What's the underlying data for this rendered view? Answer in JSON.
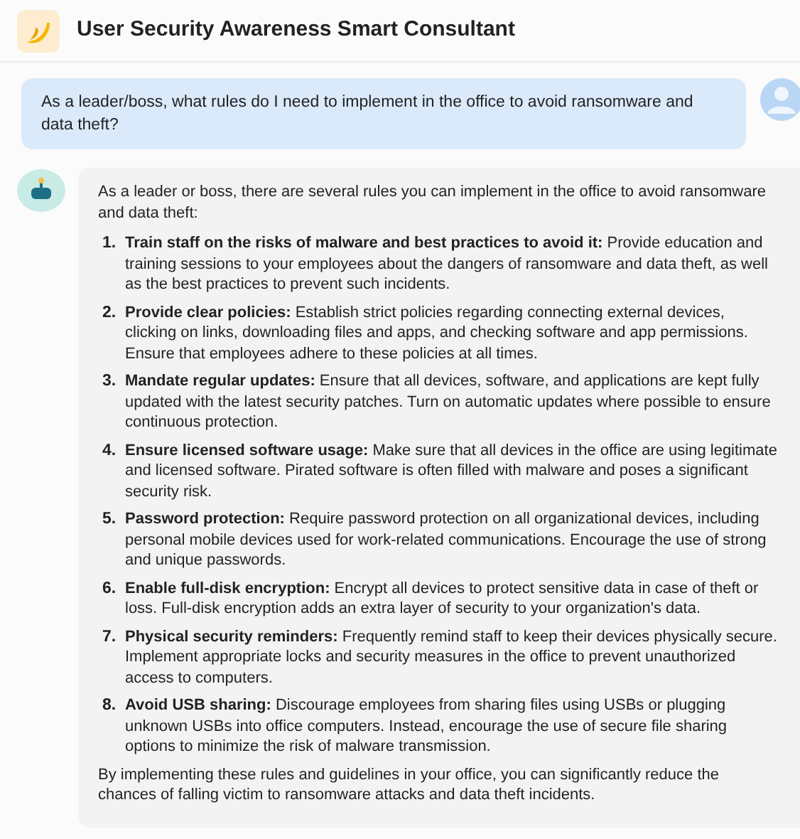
{
  "header": {
    "title": "User Security Awareness Smart Consultant"
  },
  "user_message": {
    "text": "As a leader/boss, what rules do I need to implement in the office to avoid ransomware and data theft?"
  },
  "answer": {
    "intro": "As a leader or boss, there are several rules you can implement in the office to avoid ransomware and data theft:",
    "items": [
      {
        "number": "1.",
        "text": "**Train staff on the risks of malware and best practices to avoid it:** Provide education and training sessions to your employees about the dangers of ransomware and data theft, as well as the best practices to prevent such incidents."
      },
      {
        "number": "2.",
        "text": "**Provide clear policies:** Establish strict policies regarding connecting external devices, clicking on links, downloading files and apps, and checking software and app permissions. Ensure that employees adhere to these policies at all times."
      },
      {
        "number": "3.",
        "text": "**Mandate regular updates:** Ensure that all devices, software, and applications are kept fully updated with the latest security patches. Turn on automatic updates where possible to ensure continuous protection."
      },
      {
        "number": "4.",
        "text": "**Ensure licensed software usage:** Make sure that all devices in the office are using legitimate and licensed software. Pirated software is often filled with malware and poses a significant security risk."
      },
      {
        "number": "5.",
        "text": "**Password protection:** Require password protection on all organizational devices, including personal mobile devices used for work-related communications. Encourage the use of strong and unique passwords."
      },
      {
        "number": "6.",
        "text": "**Enable full-disk encryption:** Encrypt all devices to protect sensitive data in case of theft or loss. Full-disk encryption adds an extra layer of security to your organization's data."
      },
      {
        "number": "7.",
        "text": "**Physical security reminders:** Frequently remind staff to keep their devices physically secure. Implement appropriate locks and security measures in the office to prevent unauthorized access to computers."
      },
      {
        "number": "8.",
        "text": "**Avoid USB sharing:** Discourage employees from sharing files using USBs or plugging unknown USBs into office computers. Instead, encourage the use of secure file sharing options to minimize the risk of malware transmission."
      }
    ],
    "conclusion": "By implementing these rules and guidelines in your office, you can significantly reduce the chances of falling victim to ransomware attacks and data theft incidents."
  }
}
